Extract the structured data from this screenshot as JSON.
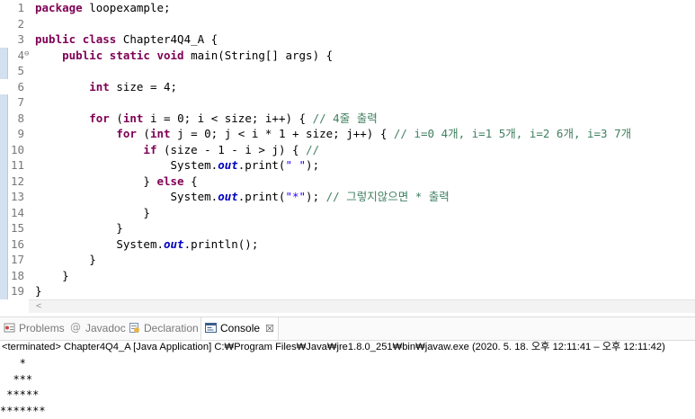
{
  "editor": {
    "line_numbers": [
      "1",
      "2",
      "3",
      "4",
      "5",
      "6",
      "7",
      "8",
      "9",
      "10",
      "11",
      "12",
      "13",
      "14",
      "15",
      "16",
      "17",
      "18",
      "19"
    ],
    "fold_marker": "⊖",
    "lines": {
      "l1": {
        "kw": "package",
        "rest": " loopexample;"
      },
      "l3": {
        "kw1": "public",
        "kw2": "class",
        "rest": " Chapter4Q4_A {"
      },
      "l4": {
        "indent": "    ",
        "kw1": "public",
        "kw2": "static",
        "kw3": "void",
        "rest": " main(String[] args) {"
      },
      "l6": {
        "indent": "        ",
        "kw": "int",
        "rest": " size = 4;"
      },
      "l8": {
        "indent": "        ",
        "kw1": "for",
        "p1": " (",
        "kw2": "int",
        "p2": " i = 0; i < size; i++) { ",
        "cm": "// 4줄 출력"
      },
      "l9": {
        "indent": "            ",
        "kw1": "for",
        "p1": " (",
        "kw2": "int",
        "p2": " j = 0; j < i * 1 + size; j++) { ",
        "cm": "// i=0 4개, i=1 5개, i=2 6개, i=3 7개"
      },
      "l10": {
        "indent": "                ",
        "kw": "if",
        "p": " (size - 1 - i > j) { ",
        "cm": "//"
      },
      "l11": {
        "indent": "                    ",
        "a": "System.",
        "st": "out",
        "b": ".print(",
        "str": "\" \"",
        "c": ");"
      },
      "l12": {
        "indent": "                } ",
        "kw": "else",
        "rest": " {"
      },
      "l13": {
        "indent": "                    ",
        "a": "System.",
        "st": "out",
        "b": ".print(",
        "str": "\"*\"",
        "c": "); ",
        "cm": "// 그렇지않으면 * 출력"
      },
      "l14": {
        "text": "                }"
      },
      "l15": {
        "text": "            }"
      },
      "l16": {
        "indent": "            ",
        "a": "System.",
        "st": "out",
        "b": ".println();"
      },
      "l17": {
        "text": "        }"
      },
      "l18": {
        "text": "    }"
      },
      "l19": {
        "text": "}"
      }
    },
    "scroll_arrow": "<"
  },
  "tabs": [
    {
      "label": "Problems",
      "icon": "problems-icon"
    },
    {
      "label": "Javadoc",
      "icon": "javadoc-icon"
    },
    {
      "label": "Declaration",
      "icon": "declaration-icon"
    },
    {
      "label": "Console",
      "icon": "console-icon",
      "active": true,
      "close": "☒"
    }
  ],
  "console": {
    "status": "<terminated> Chapter4Q4_A [Java Application] C:₩Program Files₩Java₩jre1.8.0_251₩bin₩javaw.exe  (2020. 5. 18. 오후 12:11:41 – 오후 12:11:42)",
    "output": [
      "   *",
      "  ***",
      " *****",
      "*******"
    ]
  },
  "colors": {
    "keyword": "#7f0055",
    "comment": "#3f7f5f",
    "string": "#2a00ff",
    "static_field": "#0000c0",
    "gutter_marker": "#d3e0f0"
  }
}
